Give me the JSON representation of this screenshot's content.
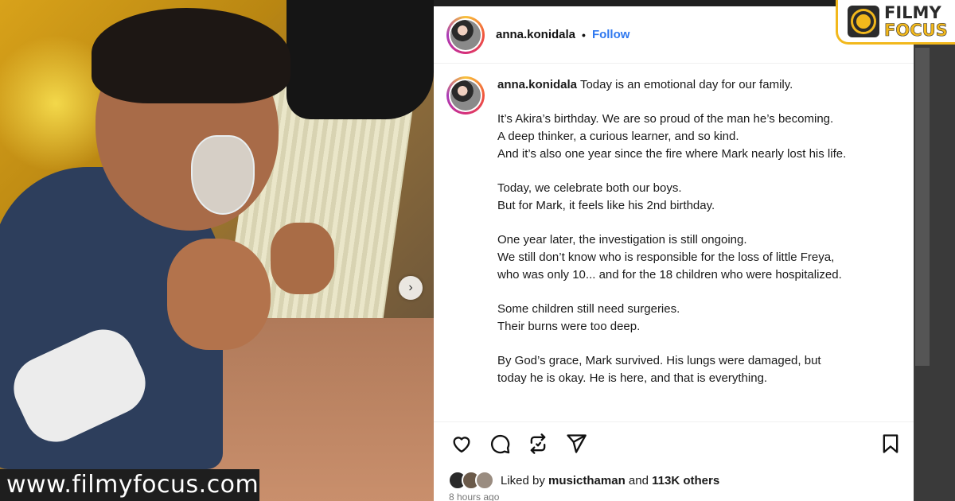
{
  "post": {
    "username": "anna.konidala",
    "dot": "•",
    "follow_label": "Follow",
    "caption_username": "anna.konidala",
    "caption_paragraphs": [
      [
        "Today is an emotional day for our family."
      ],
      [
        "It’s Akira’s birthday. We are so proud of the man he’s becoming.",
        "A deep thinker, a curious learner, and so kind.",
        "And it’s also one year since the fire where Mark nearly lost his life."
      ],
      [
        "Today, we celebrate both our boys.",
        "But for Mark, it feels like his 2nd birthday."
      ],
      [
        "One year later, the investigation is still ongoing.",
        "We still don’t know who is responsible for the loss of little Freya,",
        "who was only 10... and for the 18 children who were hospitalized."
      ],
      [
        "Some children still need surgeries.",
        "Their burns were too deep."
      ],
      [
        "By God’s grace, Mark survived. His lungs were damaged, but",
        "today he is okay. He is here, and that is everything."
      ]
    ],
    "likes": {
      "prefix": "Liked by",
      "liker": "musicthaman",
      "and": "and",
      "others": "113K others"
    },
    "timestamp": "8 hours ago"
  },
  "watermark": "www.filmyfocus.com",
  "logo": {
    "line1": "FILMY",
    "line2": "FOCUS"
  },
  "icons": [
    "heart-icon",
    "comment-icon",
    "repost-icon",
    "share-icon",
    "bookmark-icon",
    "chevron-right-icon"
  ],
  "colors": {
    "follow": "#2f78ef",
    "logo_accent": "#f2b81c"
  }
}
